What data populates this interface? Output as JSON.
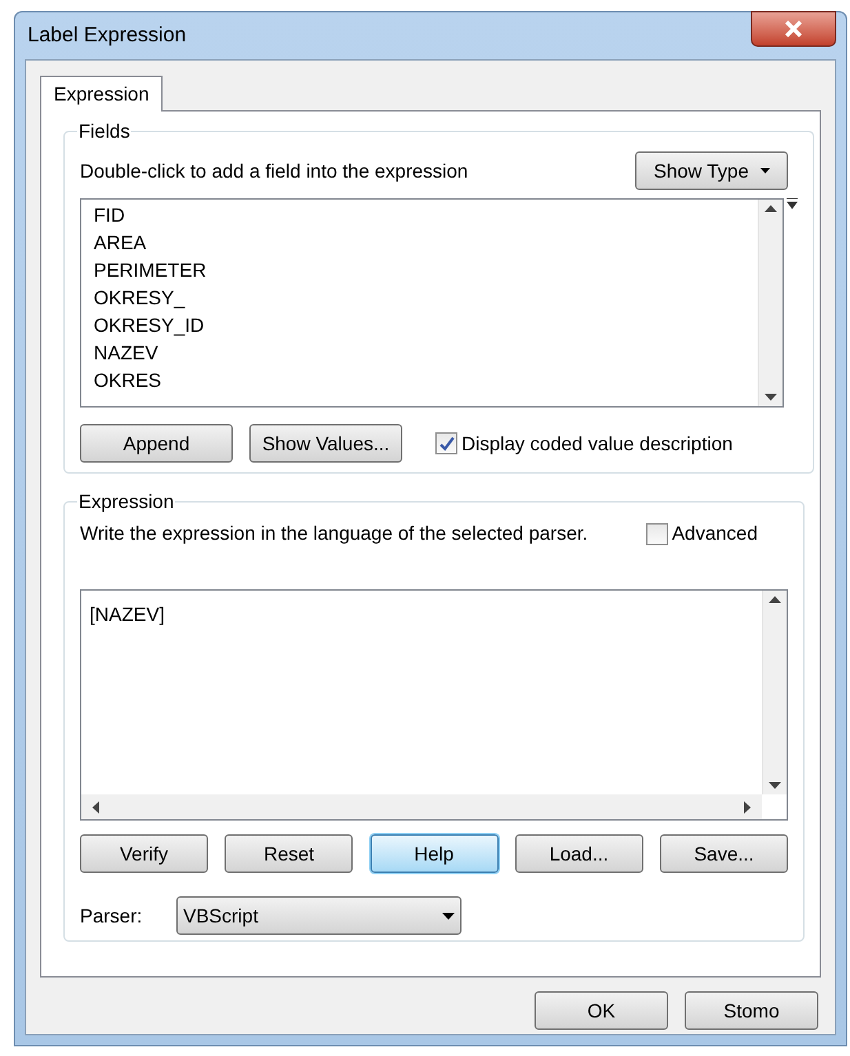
{
  "window": {
    "title": "Label Expression"
  },
  "tabs": [
    {
      "label": "Expression",
      "selected": true
    }
  ],
  "fields": {
    "title": "Fields",
    "hint": "Double-click to add a field into the expression",
    "show_type": "Show Type",
    "items": [
      {
        "label": "FID",
        "selected": false
      },
      {
        "label": "AREA",
        "selected": false
      },
      {
        "label": "PERIMETER",
        "selected": false
      },
      {
        "label": "OKRESY_",
        "selected": false
      },
      {
        "label": "OKRESY_ID",
        "selected": false
      },
      {
        "label": "NAZEV",
        "selected": false
      },
      {
        "label": "OKRES",
        "selected": false
      }
    ],
    "buttons": [
      "Append",
      "Show Values..."
    ],
    "coded_value": {
      "label": "Display coded value description",
      "checked": true
    }
  },
  "expression": {
    "title": "Expression",
    "hint": "Write the expression in the language of the selected parser.",
    "advanced": {
      "label": "Advanced",
      "checked": false
    },
    "value": "[NAZEV]",
    "buttons": [
      {
        "label": "Verify",
        "focused": false
      },
      {
        "label": "Reset",
        "focused": false
      },
      {
        "label": "Help",
        "focused": true
      },
      {
        "label": "Load...",
        "focused": false
      },
      {
        "label": "Save...",
        "focused": false
      }
    ],
    "parser_label": "Parser:",
    "parser": "VBScript"
  },
  "footer_buttons": [
    "OK",
    "Stomo"
  ]
}
